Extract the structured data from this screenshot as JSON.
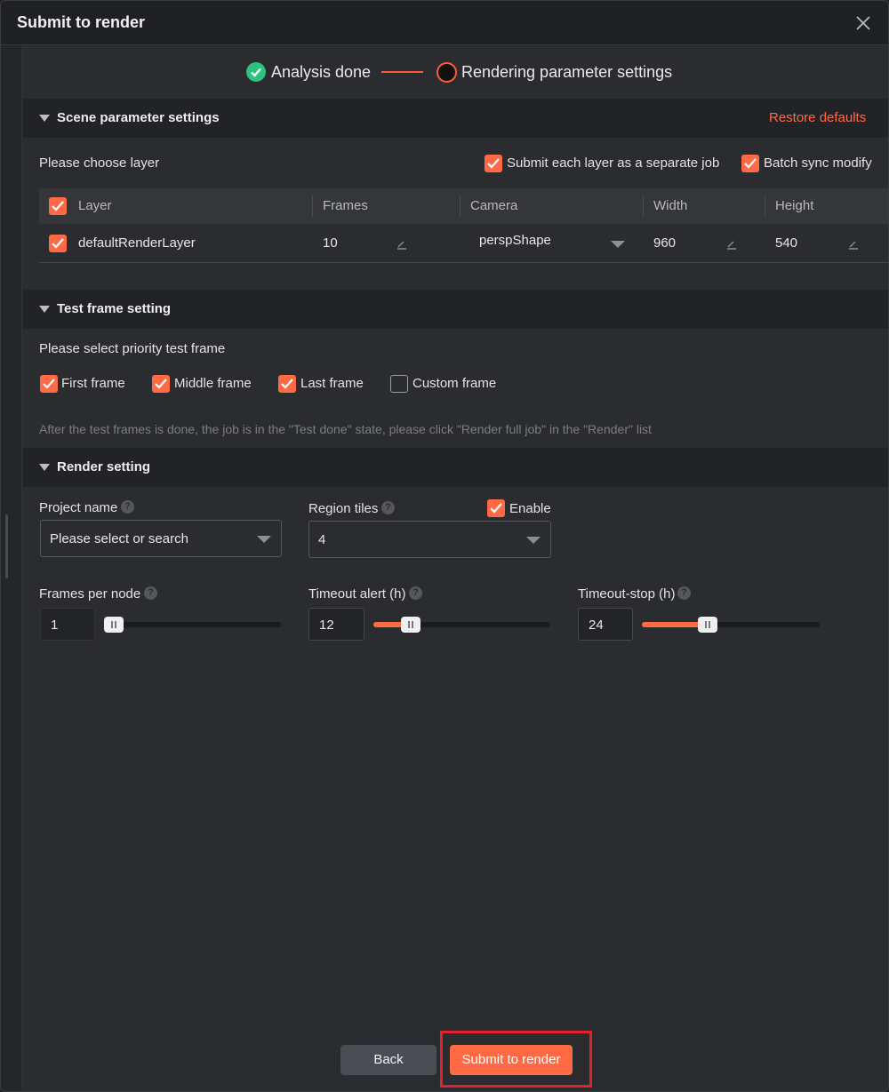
{
  "dialog": {
    "title": "Submit to render"
  },
  "steps": {
    "step1": "Analysis done",
    "step2": "Rendering parameter settings"
  },
  "scene": {
    "header": "Scene parameter settings",
    "restore": "Restore defaults",
    "choose_layer": "Please choose layer",
    "submit_each_layer": "Submit each layer as a separate job",
    "batch_sync": "Batch sync modify",
    "columns": [
      "Layer",
      "Frames",
      "Camera",
      "Width",
      "Height"
    ],
    "row": {
      "layer": "defaultRenderLayer",
      "frames": "10",
      "camera": "perspShape",
      "width": "960",
      "height": "540"
    }
  },
  "test_frame": {
    "header": "Test frame setting",
    "prompt": "Please select priority test frame",
    "first": "First frame",
    "middle": "Middle frame",
    "last": "Last frame",
    "custom": "Custom frame",
    "note": "After the test frames is done, the job is in the \"Test done\" state, please click \"Render full job\" in the \"Render\" list"
  },
  "render": {
    "header": "Render setting",
    "project_name_label": "Project name",
    "project_name_placeholder": "Please select or search",
    "region_tiles_label": "Region tiles",
    "enable_label": "Enable",
    "region_tiles_value": "4",
    "frames_per_node_label": "Frames per node",
    "frames_per_node_value": "1",
    "timeout_alert_label": "Timeout alert (h)",
    "timeout_alert_value": "12",
    "timeout_stop_label": "Timeout-stop (h)",
    "timeout_stop_value": "24",
    "help_glyph": "?"
  },
  "footer": {
    "back": "Back",
    "submit": "Submit to render"
  },
  "colors": {
    "accent": "#ff6a45",
    "success": "#2ec27e",
    "highlight": "#e0202a"
  },
  "icons": [
    "close-icon",
    "check-circle-icon",
    "checkbox-check-icon",
    "pencil-icon",
    "chevron-down-icon",
    "help-icon",
    "caret-down-icon"
  ]
}
